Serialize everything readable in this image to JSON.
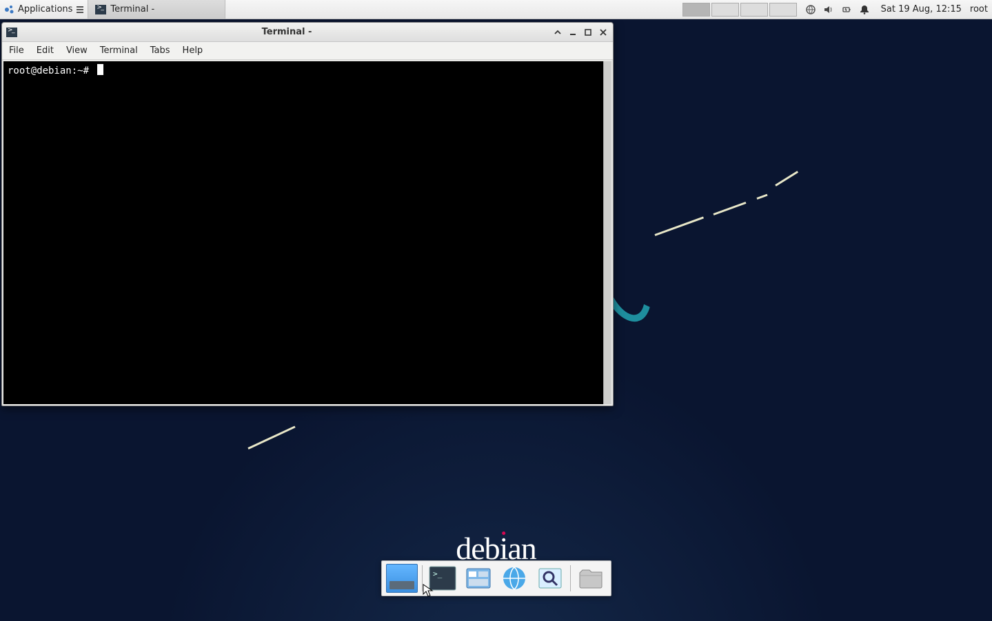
{
  "panel": {
    "applications_label": "Applications",
    "taskbar_item_label": "Terminal -",
    "clock": "Sat 19 Aug, 12:15",
    "user": "root",
    "icons": {
      "network": "network-icon",
      "volume": "volume-icon",
      "power": "power-icon",
      "notify": "notification-icon"
    }
  },
  "workspaces": {
    "count": 4,
    "active": 0
  },
  "terminal": {
    "title": "Terminal -",
    "menus": {
      "file": "File",
      "edit": "Edit",
      "view": "View",
      "terminal": "Terminal",
      "tabs": "Tabs",
      "help": "Help"
    },
    "prompt": "root@debian:~# "
  },
  "dock": {
    "items": {
      "show_desktop": "show-desktop-icon",
      "terminal": "terminal-icon",
      "files": "file-manager-icon",
      "web": "web-browser-icon",
      "search": "app-finder-icon",
      "folder": "folder-icon"
    }
  },
  "branding": {
    "debian": "debian"
  }
}
